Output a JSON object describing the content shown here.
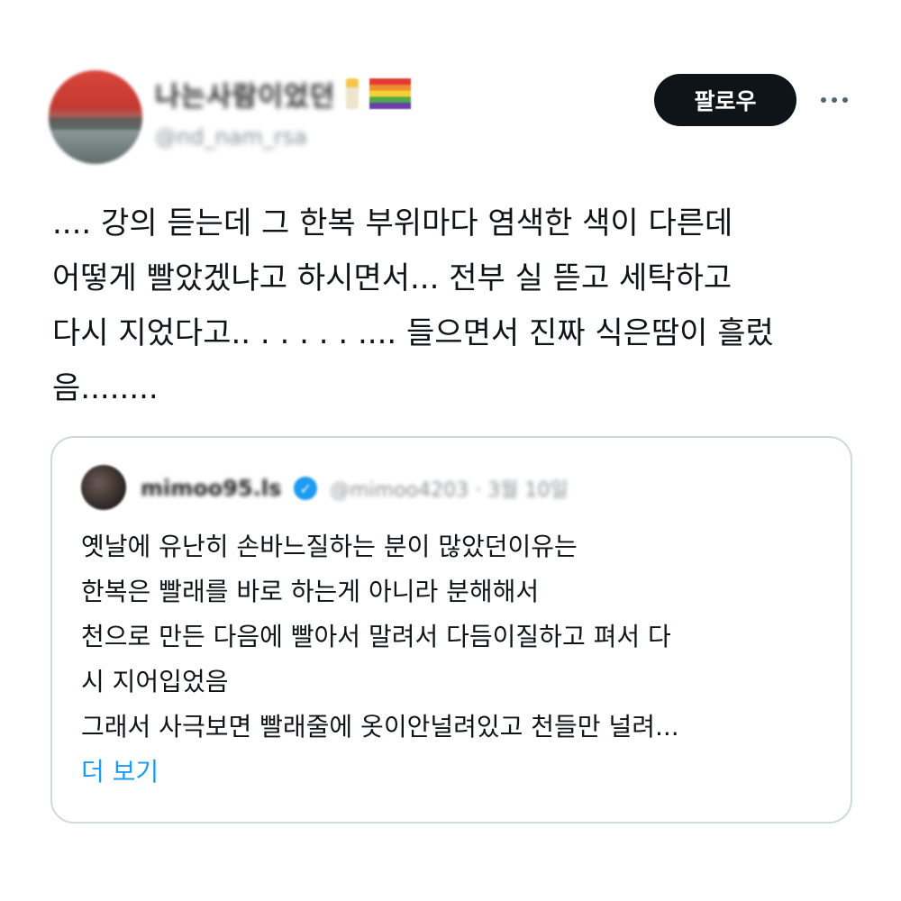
{
  "author": {
    "display_name": "나는사람이었던",
    "handle": "@nd_nam_rsa",
    "emoji": [
      "candle",
      "rainbow-flag"
    ]
  },
  "actions": {
    "follow_label": "팔로우",
    "more_icon": "more-horizontal-icon"
  },
  "tweet": {
    "lines": [
      ".... 강의 듣는데 그 한복 부위마다 염색한 색이 다른데",
      "어떻게 빨았겠냐고 하시면서... 전부 실 뜯고 세탁하고",
      "다시 지었다고.. . . . . . .... 들으면서 진짜 식은땀이 흘렀",
      "음........"
    ]
  },
  "quote": {
    "author_name": "mimoo95.ls",
    "author_sub": "@mimoo4203 · 3월 10일",
    "verified_icon": "verified-badge-icon",
    "lines": [
      "옛날에 유난히 손바느질하는 분이 많았던이유는",
      "한복은 빨래를 바로 하는게 아니라 분해해서",
      "천으로 만든 다음에 빨아서 말려서 다듬이질하고 펴서 다",
      "시 지어입었음",
      "그래서 사극보면 빨래줄에 옷이안널려있고 천들만 널려..."
    ],
    "show_more_label": "더 보기"
  },
  "colors": {
    "button_bg": "#0f1419",
    "link": "#1d9bf0",
    "border": "#cfd9de",
    "secondary_text": "#536471"
  }
}
